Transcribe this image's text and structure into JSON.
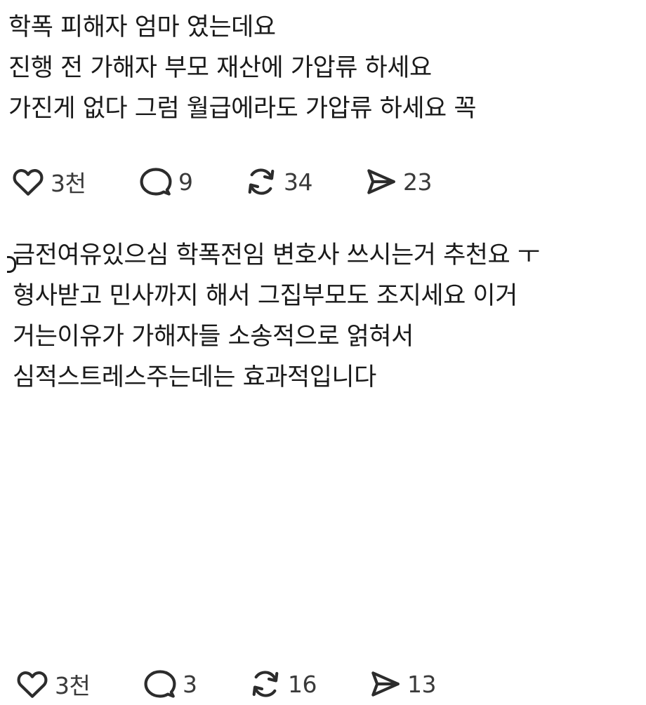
{
  "posts": [
    {
      "lines": [
        "학폭 피해자 엄마 였는데요",
        "진행 전 가해자 부모 재산에 가압류 하세요",
        "가진게 없다 그럼 월급에라도 가압류 하세요 꼭"
      ],
      "stats": {
        "likes": "3천",
        "replies": "9",
        "reposts": "34",
        "shares": "23"
      }
    },
    {
      "lines": [
        "금전여유있으심 학폭전임 변호사 쓰시는거 추천요 ㅜ",
        "형사받고 민사까지 해서 그집부모도 조지세요 이거",
        "거는이유가 가해자들 소송적으로 얽혀서",
        "심적스트레스주는데는 효과적입니다"
      ],
      "stats": {
        "likes": "3천",
        "replies": "3",
        "reposts": "16",
        "shares": "13"
      }
    }
  ],
  "icons": {
    "like": "heart-icon",
    "reply": "comment-bubble-icon",
    "repost": "repost-arrows-icon",
    "share": "send-paper-plane-icon"
  },
  "colors": {
    "background": "#ffffff",
    "text": "#1a1a1a",
    "icon": "#2c2c2c"
  }
}
